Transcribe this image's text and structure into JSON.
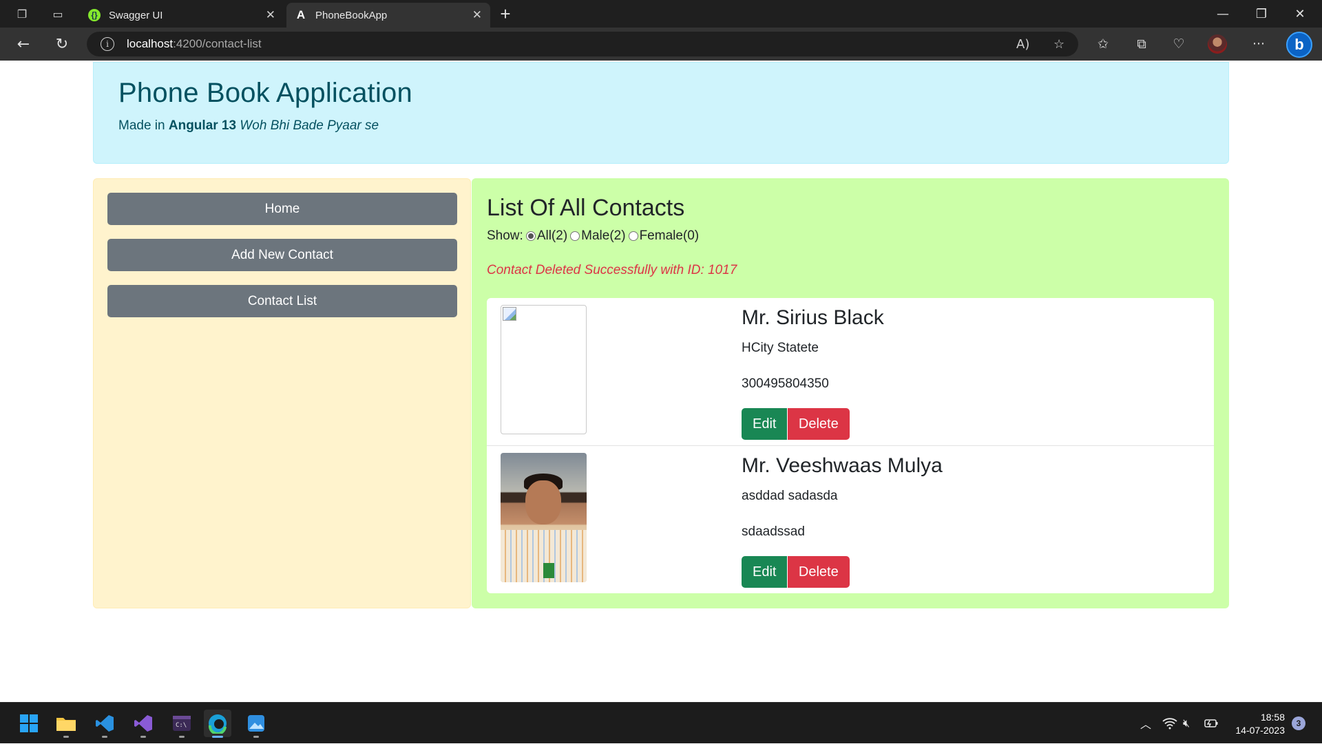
{
  "browser": {
    "tabs": [
      {
        "title": "Swagger UI",
        "icon": "swagger-icon",
        "active": false
      },
      {
        "title": "PhoneBookApp",
        "icon": "angular-icon",
        "active": true
      }
    ],
    "url_host": "localhost",
    "url_path": ":4200/contact-list"
  },
  "header": {
    "title": "Phone Book Application",
    "subtitle_prefix": "Made in ",
    "subtitle_bold": "Angular 13",
    "subtitle_italic": "Woh Bhi Bade Pyaar se"
  },
  "sidebar": {
    "items": [
      {
        "label": "Home"
      },
      {
        "label": "Add New Contact"
      },
      {
        "label": "Contact List"
      }
    ]
  },
  "main": {
    "title": "List Of All Contacts",
    "filter_label": "Show:",
    "filter_options": [
      {
        "label": "All(2)",
        "checked": true
      },
      {
        "label": "Male(2)",
        "checked": false
      },
      {
        "label": "Female(0)",
        "checked": false
      }
    ],
    "message": "Contact Deleted Successfully with ID: 1017",
    "contacts": [
      {
        "name": "Mr. Sirius Black",
        "address": "HCity Statete",
        "phone": "300495804350",
        "photo": "broken-image",
        "edit_label": "Edit",
        "delete_label": "Delete"
      },
      {
        "name": "Mr. Veeshwaas Mulya",
        "address": "asddad sadasda",
        "phone": "sdaadssad",
        "photo": "person-photo",
        "edit_label": "Edit",
        "delete_label": "Delete"
      }
    ]
  },
  "taskbar": {
    "time": "18:58",
    "date": "14-07-2023",
    "notification_count": "3"
  },
  "colors": {
    "header_bg": "#cff4fc",
    "sidebar_bg": "#fff3cd",
    "main_bg": "#ccffa8",
    "message": "#dc3545",
    "edit": "#198754",
    "delete": "#dc3545",
    "nav_button": "#6c757d"
  }
}
